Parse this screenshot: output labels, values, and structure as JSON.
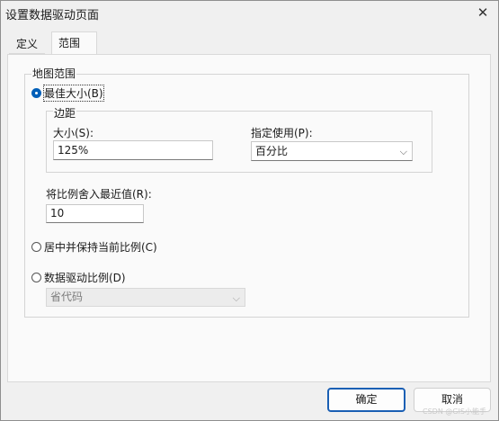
{
  "window": {
    "title": "设置数据驱动页面",
    "close_glyph": "✕"
  },
  "tabs": [
    {
      "label": "定义",
      "active": false
    },
    {
      "label": "范围",
      "active": true
    }
  ],
  "map_extent": {
    "group_label": "地图范围",
    "best_fit": {
      "label": "最佳大小(B)",
      "checked": true,
      "margin_group_label": "边距",
      "size_label": "大小(S):",
      "size_value": "125%",
      "unit_label": "指定使用(P):",
      "unit_value": "百分比"
    },
    "round_label": "将比例舍入最近值(R):",
    "round_value": "10",
    "center_keep": {
      "label": "居中并保持当前比例(C)",
      "checked": false
    },
    "data_driven": {
      "label": "数据驱动比例(D)",
      "checked": false,
      "field_value": "省代码"
    }
  },
  "buttons": {
    "ok": "确定",
    "cancel": "取消"
  },
  "watermark": "CSDN @GIS小能手",
  "colors": {
    "accent": "#005fb8",
    "primary_border": "#1a5fb4",
    "dialog_bg": "#f0f0f0",
    "panel_bg": "#fafafa"
  },
  "icons": {
    "chevron": "chevron-down-icon",
    "close": "close-icon"
  }
}
